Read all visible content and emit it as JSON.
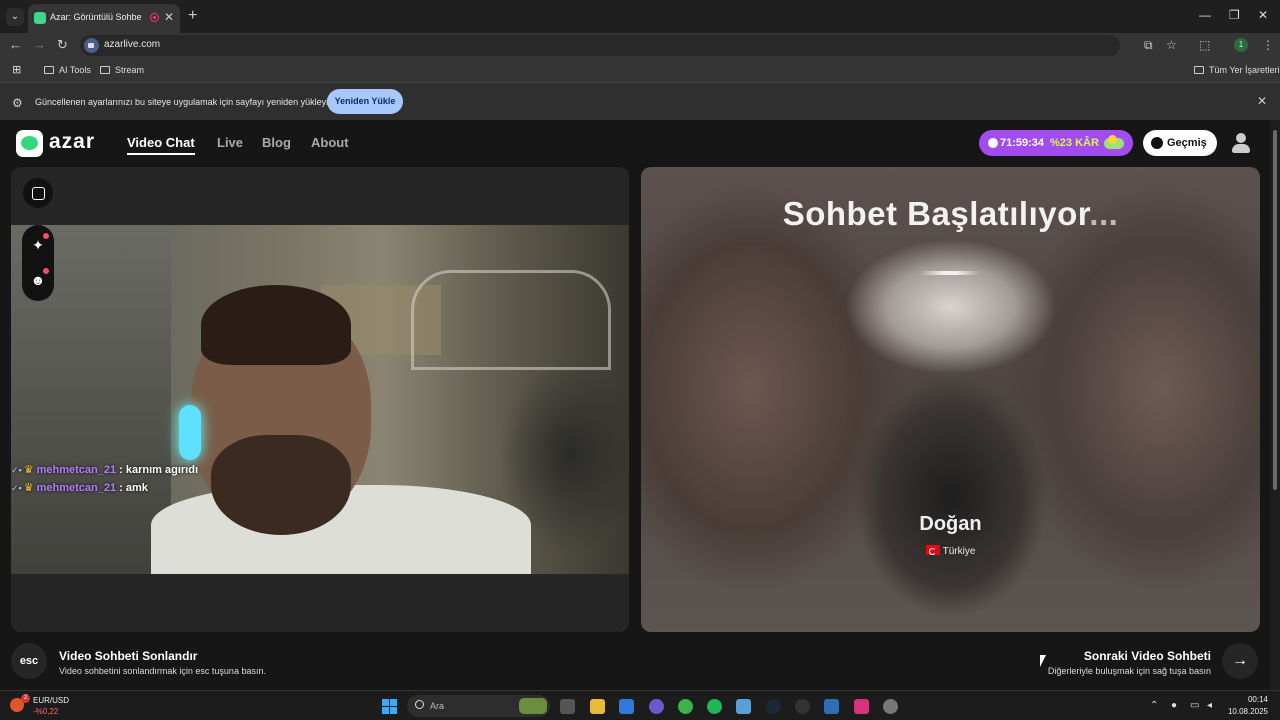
{
  "browser": {
    "tab_title": "Azar: Görüntülü Sohbet, Arkadaş",
    "url": "azarlive.com",
    "bookmarks": [
      "AI Tools",
      "Stream"
    ],
    "all_bookmarks": "Tüm Yer İşaretleri",
    "profile_initial": "1"
  },
  "infobar": {
    "message": "Güncellenen ayarlarınızı bu siteye uygulamak için sayfayı yeniden yükleyin",
    "reload_label": "Yeniden Yükle"
  },
  "header": {
    "logo_text": "azar",
    "nav": [
      "Video Chat",
      "Live",
      "Blog",
      "About"
    ],
    "active_nav": "Video Chat",
    "timer": "71:59:34",
    "discount": "%23 KÂR",
    "history_label": "Geçmiş"
  },
  "chat": [
    {
      "user": "mehmetcan_21",
      "message": ": karnım agırıdı"
    },
    {
      "user": "mehmetcan_21",
      "message": ": amk"
    }
  ],
  "remote": {
    "status": "Sohbet Başlatılıyor",
    "ellipsis": "...",
    "name": "Doğan",
    "country": "Türkiye"
  },
  "controls": {
    "esc_key": "esc",
    "end_title": "Video Sohbeti Sonlandır",
    "end_subtitle": "Video sohbetini sonlandırmak için esc tuşuna basın.",
    "next_title": "Sonraki Video Sohbeti",
    "next_subtitle": "Diğerleriyle buluşmak için sağ tuşa basın"
  },
  "taskbar": {
    "ticker_name": "EUR/USD",
    "ticker_value": "-%0,22",
    "ticker_badge": "2",
    "search_placeholder": "Ara",
    "time": "00:14",
    "date": "10.08.2025"
  },
  "colors": {
    "brand_green": "#36d67d",
    "timer_purple": "#a24cf0",
    "chat_username": "#b57bff",
    "reload_button": "#a8c7fa"
  }
}
